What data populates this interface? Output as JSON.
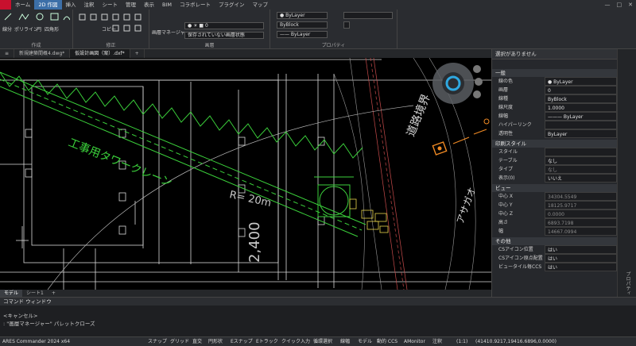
{
  "menu": {
    "tabs": [
      "ホーム",
      "2D 作図",
      "挿入",
      "注釈",
      "シート",
      "管理",
      "表示",
      "BIM",
      "コラボレート",
      "プラグイン",
      "マップ"
    ],
    "active_index": 1
  },
  "ribbon": {
    "draw_group": "作成",
    "modify_group": "修正",
    "layer_group": "画層",
    "props_group": "プロパティ",
    "draw_buttons": [
      "線分",
      "ポリライン",
      "円",
      "四角形"
    ],
    "copy_label": "コピー",
    "layer_manager": "画層マネージャー",
    "layer_current": "0",
    "layer_state": "保存されていない画層状態",
    "color": "ByLayer",
    "linetype": "ByBlock",
    "lineweight": "ByLayer"
  },
  "doc_tabs": [
    "新規建築間概4.dwg*",
    "仮設計画図（案）.dxf*"
  ],
  "layout_tabs": [
    "モデル",
    "シート1"
  ],
  "drawing": {
    "crane_label": "工事用タワークレーン",
    "radius_label": "R= 20m",
    "dim_label": "2,400",
    "road_label": "道路境界",
    "asahi_label": "アサガオ"
  },
  "properties": {
    "header": "選択がありません",
    "general": {
      "title": "一般",
      "rows": [
        {
          "k": "線の色",
          "v": "● ByLayer"
        },
        {
          "k": "画層",
          "v": "0"
        },
        {
          "k": "線種",
          "v": "ByBlock"
        },
        {
          "k": "線尺度",
          "v": "1.0000"
        },
        {
          "k": "線幅",
          "v": "——— ByLayer"
        },
        {
          "k": "ハイパーリンク",
          "v": ""
        },
        {
          "k": "透明性",
          "v": "ByLayer"
        }
      ]
    },
    "print": {
      "title": "印刷スタイル",
      "rows": [
        {
          "k": "スタイル",
          "v": ""
        },
        {
          "k": "テーブル",
          "v": "なし"
        },
        {
          "k": "タイプ",
          "v": "なし"
        },
        {
          "k": "表示(0)",
          "v": "いいえ"
        }
      ]
    },
    "view": {
      "title": "ビュー",
      "rows": [
        {
          "k": "中心 X",
          "v": "34304.5549"
        },
        {
          "k": "中心 Y",
          "v": "18125.9717"
        },
        {
          "k": "中心 Z",
          "v": "0.0000"
        },
        {
          "k": "高さ",
          "v": "6893.7198"
        },
        {
          "k": "幅",
          "v": "14667.0994"
        }
      ]
    },
    "misc": {
      "title": "その他",
      "rows": [
        {
          "k": "CSアイコン位置",
          "v": "はい"
        },
        {
          "k": "CSアイコン原点配置",
          "v": "はい"
        },
        {
          "k": "ビュータイル毎CCS",
          "v": "はい"
        }
      ]
    },
    "side_label": "プロパティ"
  },
  "command": {
    "title": "コマンド ウィンドウ",
    "lines": [
      "<キャンセル>",
      ": \"画層マネージャー\" パレットクローズ"
    ]
  },
  "status": {
    "app": "ARES Commander 2024 x64",
    "buttons": [
      "スナップ",
      "グリッド",
      "直交",
      "円形状",
      "Eスナップ",
      "Eトラック",
      "クイック入力",
      "循環選択",
      "線幅",
      "モデル",
      "動的 CCS",
      "AMonitor",
      "注釈"
    ],
    "scale": "(1:1)",
    "coords": "(41410.9217,19416.6896,0.0000)"
  }
}
